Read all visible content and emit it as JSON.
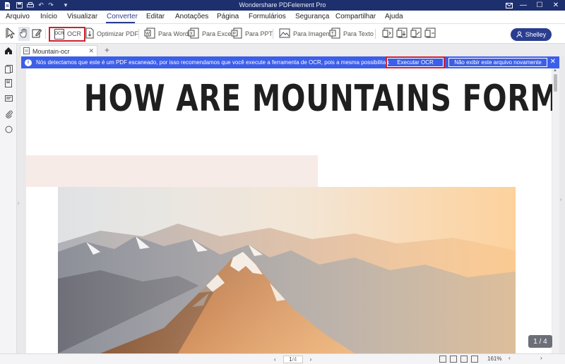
{
  "app": {
    "title": "Wondershare PDFelement Pro"
  },
  "menu": {
    "items": [
      "Arquivo",
      "Início",
      "Visualizar",
      "Converter",
      "Editar",
      "Anotações",
      "Página",
      "Formulários",
      "Segurança",
      "Compartilhar",
      "Ajuda"
    ],
    "active": "Converter"
  },
  "toolbar": {
    "ocr_label": "OCR",
    "optimize_label": "Optimizar PDF",
    "to_word": "Para Word",
    "to_excel": "Para Excel",
    "to_ppt": "Para PPT",
    "to_image": "Para Imagem",
    "to_text": "Para Texto",
    "user_label": "Shelley"
  },
  "tabs": {
    "doc_tab": "Mountain-ocr",
    "add_symbol": "+"
  },
  "notice": {
    "message": "Nós detectamos que este é um PDF escaneado, por isso recomendamos que você execute a ferramenta de OCR, pois a mesma possibilita que você ...",
    "run_ocr": "Executar OCR",
    "dont_show": "Não exibir este arquivo novamente"
  },
  "document": {
    "heading": "HOW ARE MOUNTAINS FORMED?"
  },
  "pager": {
    "label": "1 / 4"
  },
  "status": {
    "page_current": "1",
    "page_total": "/4",
    "zoom": "161%"
  },
  "colors": {
    "titlebar": "#1e2f6e",
    "accent": "#2b3e8c",
    "notice": "#3c5ee8",
    "highlight": "#d0202e"
  }
}
